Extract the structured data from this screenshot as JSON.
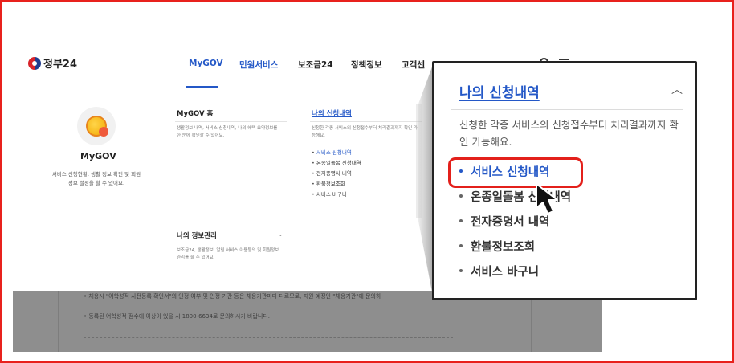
{
  "header": {
    "logo_text": "정부24",
    "nav": [
      "MyGOV",
      "민원서비스",
      "보조금24",
      "정책정보",
      "고객센"
    ]
  },
  "left_panel": {
    "title": "MyGOV",
    "desc": "서비스 신청현황, 생활 정보 확인 및 회원정보 설정을 할 수 있어요."
  },
  "menu": {
    "mygov_home": {
      "title": "MyGOV 홈",
      "desc": "생활정보 내역, 서비스 신청내역, 나의 혜택 요약정보를 한 눈에 확인할 수 있어요."
    },
    "my_info": {
      "title": "나의 정보관리",
      "desc": "보조금24, 생활정보, 알림 서비스 이용등의 및 회원정보 관리를 할 수 있어요."
    },
    "my_apps": {
      "title": "나의 신청내역",
      "desc": "신청한 각종 서비스의 신청접수부터 처리결과까지 확인 가능해요.",
      "items": [
        "서비스 신청내역",
        "온종일돌봄 신청내역",
        "전자증명서 내역",
        "환불정보조회",
        "서비스 바구니"
      ]
    }
  },
  "background_notes": [
    "채용시 \"어학성적 사전등록 확인서\"의 인정 여부 및 인정 기간 등은 채용기관마다 다르므로, 지원 예정인 \"채용기관\"에 문의하",
    "등록된 어학성적 점수에 이상이 있을 시 1800-6634로 문의하시기 바랍니다."
  ],
  "zoom": {
    "title": "나의 신청내역",
    "desc": "신청한 각종 서비스의 신청접수부터 처리결과까지 확인 가능해요.",
    "items": [
      "서비스 신청내역",
      "온종일돌봄 신청내역",
      "전자증명서 내역",
      "환불정보조회",
      "서비스 바구니"
    ]
  },
  "colors": {
    "accent": "#2458c7",
    "highlight": "#e3201b",
    "frame": "#e8211d"
  },
  "icons": [
    "gov-emblem-icon",
    "mygov-coin-icon",
    "chevron-up-icon",
    "chevron-down-icon",
    "search-icon",
    "menu-icon",
    "mouse-cursor-icon"
  ]
}
